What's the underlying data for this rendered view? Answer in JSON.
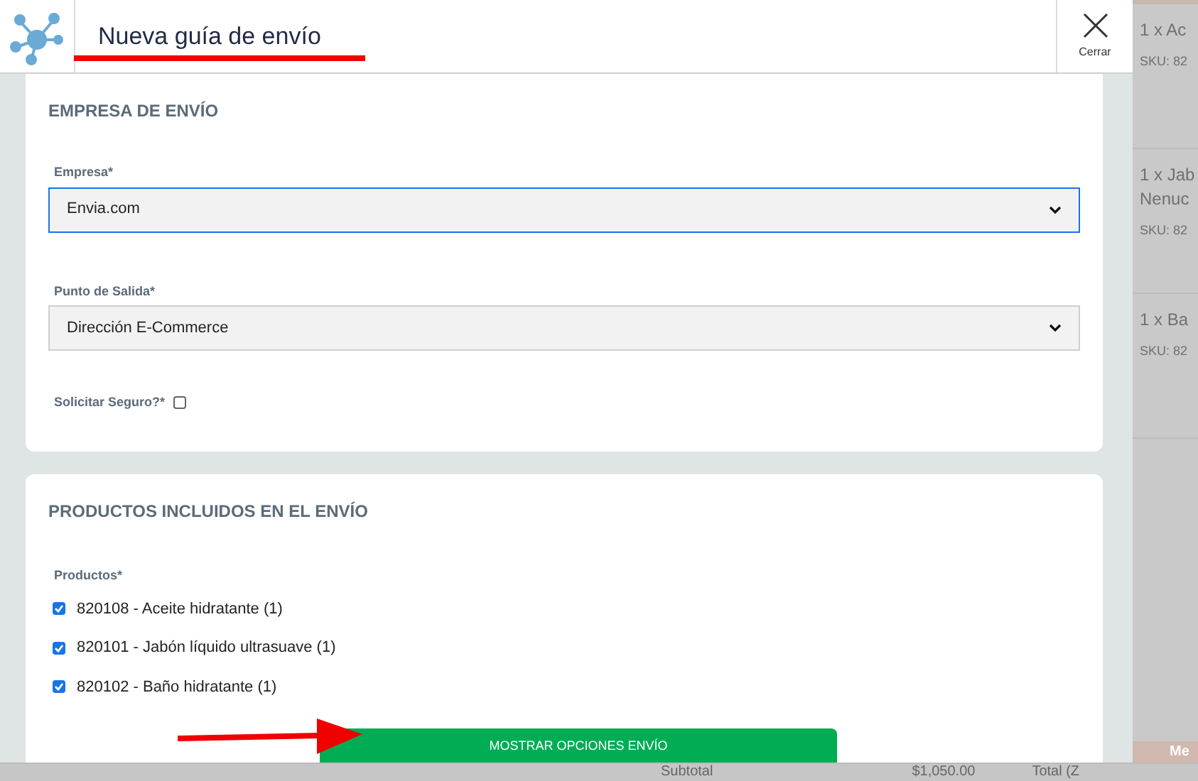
{
  "header": {
    "title": "Nueva guía de envío",
    "close_label": "Cerrar"
  },
  "shipping_company": {
    "heading": "EMPRESA DE ENVÍO",
    "fields": [
      {
        "label": "Empresa*",
        "value": "Envia.com",
        "focused": true
      },
      {
        "label": "Punto de Salida*",
        "value": "Dirección E-Commerce",
        "focused": false
      }
    ],
    "insurance": {
      "label": "Solicitar Seguro?*",
      "checked": false
    }
  },
  "products_section": {
    "heading": "PRODUCTOS INCLUIDOS EN EL ENVÍO",
    "label": "Productos*",
    "products": [
      {
        "label": "820108 - Aceite hidratante (1)",
        "checked": true
      },
      {
        "label": "820101 - Jabón líquido ultrasuave (1)",
        "checked": true
      },
      {
        "label": "820102 - Baño hidratante (1)",
        "checked": true
      }
    ],
    "button": "MOSTRAR OPCIONES ENVÍO"
  },
  "background_panel": {
    "items": [
      {
        "name": [
          "1 x Ac"
        ],
        "sku": "SKU: 82"
      },
      {
        "name": [
          "1 x Jab",
          "Nenuc"
        ],
        "sku": "SKU: 82"
      },
      {
        "name": [
          "1 x Ba"
        ],
        "sku": "SKU: 82"
      }
    ],
    "footer_button": "Me",
    "totals": [
      "Subtotal",
      "$1,050.00",
      "Total (Z"
    ]
  }
}
